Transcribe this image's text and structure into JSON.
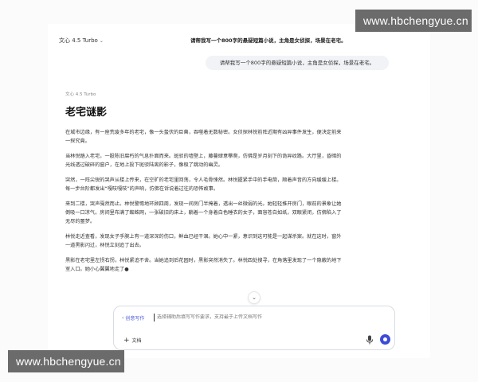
{
  "watermark": {
    "text": "www.hbchengyue.cn"
  },
  "header": {
    "model_name": "文心 4.5 Turbo",
    "title": "请帮我写一个800字的悬疑短篇小说，主角是女侦探，场景在老宅。"
  },
  "conversation": {
    "user_message": "请帮我写一个800字的悬疑短篇小说，主角是女侦探，场景在老宅。",
    "answer_model": "文心 4.5 Turbo",
    "story_title": "老宅谜影",
    "paragraphs": [
      "在城市边缘，有一座荒废多年的老宅，像一头蛰伏的巨兽，吞噬着无数秘密。女侦探林悦前阵近期有凶异事件发生，便决定前来一探究竟。",
      "当林悦踏入老宅，一股陈旧腐朽的气息扑面而来。斑驳的墙壁上，藤蔓肆意攀爬，仿佛是岁月刻下的诡异纹路。大厅里，昏暗的光线透过破碎的窗户，在地上投下斑驳陆离的影子，像极了跳动的幽灵。",
      "突然，一阵尖锐的哭声从楼上传来，在空旷的老宅里回荡，令人毛骨悚然。林悦握紧手中的手电筒，顺着声音的方向缓缓上楼。每一步台阶都发出“嘎吱嘎吱”的声响，仿佛在诉说着过往的恐怖故事。",
      "来到二楼，哭声戛然而止。林悦警惕地环顾四周，发现一间房门半掩着，透出一丝微弱的光。她轻轻推开房门，眼前的景象让她倒吸一口凉气。房间里布满了蜘蛛网，一张破旧的床上，躺着一个身着白色睡衣的女子，面容苍白如纸，双眼紧闭，仿佛陷入了无尽的噩梦。",
      "林悦走近查看，发现女子手腕上有一道深深的伤口，鲜血已经干涸。她心中一紧，意识到这可能是一起谋杀案。就在这时，窗外一道黑影闪过，林悦立刻追了出去。",
      "黑影在老宅里左拐右拐，林悦紧追不舍。当她追到后花园时，黑影突然消失了。林悦四处搜寻，在角落里发现了一个隐蔽的地下室入口。她小心翼翼地走了●"
    ]
  },
  "composer": {
    "mode_label": "创意写作",
    "placeholder": "选择辅助后填写写作要求，支持最于上传文档写作",
    "attach_label": "文档"
  },
  "icons": {
    "model_chevron": "chevron-down-icon",
    "scroll_down": "chevron-down-icon",
    "mode_back": "chevron-left-icon",
    "attach": "plus-icon",
    "mic": "microphone-icon",
    "send": "send-icon"
  },
  "colors": {
    "accent": "#3d4bd9",
    "watermark_bg": "#6b6b6b"
  }
}
